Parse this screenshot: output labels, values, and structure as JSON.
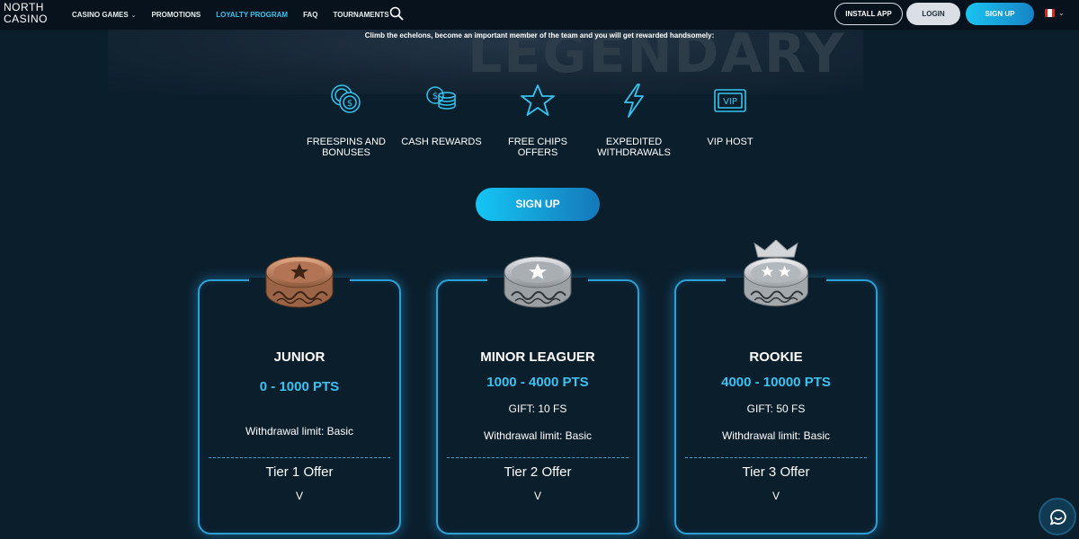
{
  "header": {
    "logo_line1": "NORTH",
    "logo_line2": "CASINO",
    "nav": [
      {
        "label": "CASINO GAMES",
        "has_dropdown": true
      },
      {
        "label": "PROMOTIONS"
      },
      {
        "label": "LOYALTY PROGRAM",
        "active": true
      },
      {
        "label": "FAQ"
      },
      {
        "label": "TOURNAMENTS"
      }
    ],
    "install_label": "INSTALL APP",
    "login_label": "LOGIN",
    "signup_label": "SIGN UP",
    "language_flag": "canada-flag"
  },
  "banner": {
    "word": "LEGENDARY",
    "tagline": "Climb the echelons, become an important member of the team and you will get rewarded handsomely:"
  },
  "features": [
    {
      "icon": "poker-chips-dollar-icon",
      "line1": "FREESPINS AND",
      "line2": "BONUSES"
    },
    {
      "icon": "coin-stack-icon",
      "line1": "CASH REWARDS",
      "line2": ""
    },
    {
      "icon": "star-icon",
      "line1": "FREE CHIPS",
      "line2": "OFFERS"
    },
    {
      "icon": "lightning-icon",
      "line1": "EXPEDITED",
      "line2": "WITHDRAWALS"
    },
    {
      "icon": "vip-ticket-icon",
      "line1": "VIP HOST",
      "line2": ""
    }
  ],
  "signup_main_label": "SIGN UP",
  "tiers": [
    {
      "title": "JUNIOR",
      "points": "0 - 1000 PTS",
      "gift": "",
      "limit": "Withdrawal limit: Basic",
      "offer": "Tier 1 Offer",
      "chevron": "V",
      "badge_color": "#c08a68"
    },
    {
      "title": "MINOR LEAGUER",
      "points": "1000 - 4000 PTS",
      "gift": "GIFT: 10 FS",
      "limit": "Withdrawal limit: Basic",
      "offer": "Tier 2 Offer",
      "chevron": "V",
      "badge_color": "#b8bcc0"
    },
    {
      "title": "ROOKIE",
      "points": "4000 - 10000 PTS",
      "gift": "GIFT: 50 FS",
      "limit": "Withdrawal limit: Basic",
      "offer": "Tier 3 Offer",
      "chevron": "V",
      "badge_color": "#d8dadc"
    }
  ],
  "colors": {
    "accent": "#35c4ef",
    "background": "#0b1e2c",
    "card_border": "#2c9fd6"
  }
}
